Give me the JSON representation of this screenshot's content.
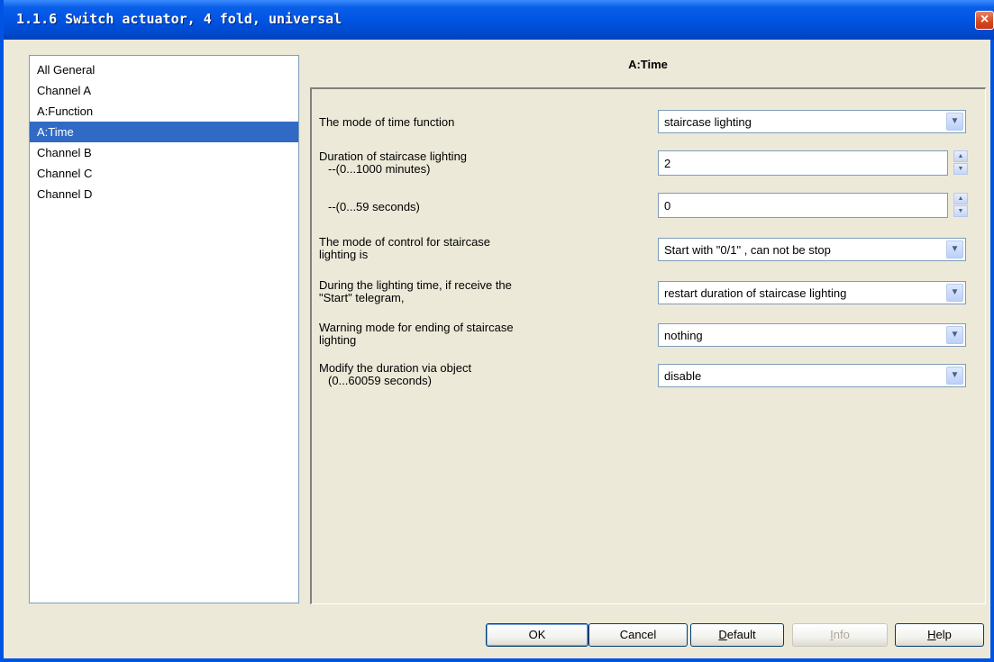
{
  "window": {
    "title": "1.1.6 Switch actuator, 4 fold, universal",
    "close_glyph": "×"
  },
  "tree": {
    "items": [
      {
        "label": "All General",
        "selected": false
      },
      {
        "label": "Channel A",
        "selected": false
      },
      {
        "label": "A:Function",
        "selected": false
      },
      {
        "label": "A:Time",
        "selected": true
      },
      {
        "label": "Channel B",
        "selected": false
      },
      {
        "label": "Channel C",
        "selected": false
      },
      {
        "label": "Channel D",
        "selected": false
      }
    ]
  },
  "panel": {
    "title": "A:Time",
    "params": [
      {
        "label": "The mode of time function",
        "value": "staircase lighting",
        "control": "dropdown"
      },
      {
        "label_line1": "Duration of staircase lighting",
        "label_line2": "--(0...1000 minutes)",
        "value": "2",
        "control": "spinner"
      },
      {
        "label": "--(0...59 seconds)",
        "value": "0",
        "control": "spinner"
      },
      {
        "label_line1": "The mode of control for staircase",
        "label_line2": "lighting is",
        "value": "Start with \"0/1\" , can not be stop",
        "control": "dropdown"
      },
      {
        "label_line1": "During the lighting time, if receive the",
        "label_line2": "\"Start\" telegram,",
        "value": "restart duration of staircase lighting",
        "control": "dropdown"
      },
      {
        "label_line1": "Warning mode for ending of staircase",
        "label_line2": "lighting",
        "value": "nothing",
        "control": "dropdown"
      },
      {
        "label_line1": "Modify the duration via object",
        "label_line2": "(0...60059 seconds)",
        "value": "disable",
        "control": "dropdown"
      }
    ]
  },
  "buttons": {
    "ok": "OK",
    "cancel": "Cancel",
    "default_first": "D",
    "default_rest": "efault",
    "info_first": "I",
    "info_rest": "nfo",
    "help_first": "H",
    "help_rest": "elp"
  },
  "icons": {
    "dropdown": "chevron-down-icon",
    "spinner": "spinner-arrows-icon",
    "close": "close-icon"
  }
}
